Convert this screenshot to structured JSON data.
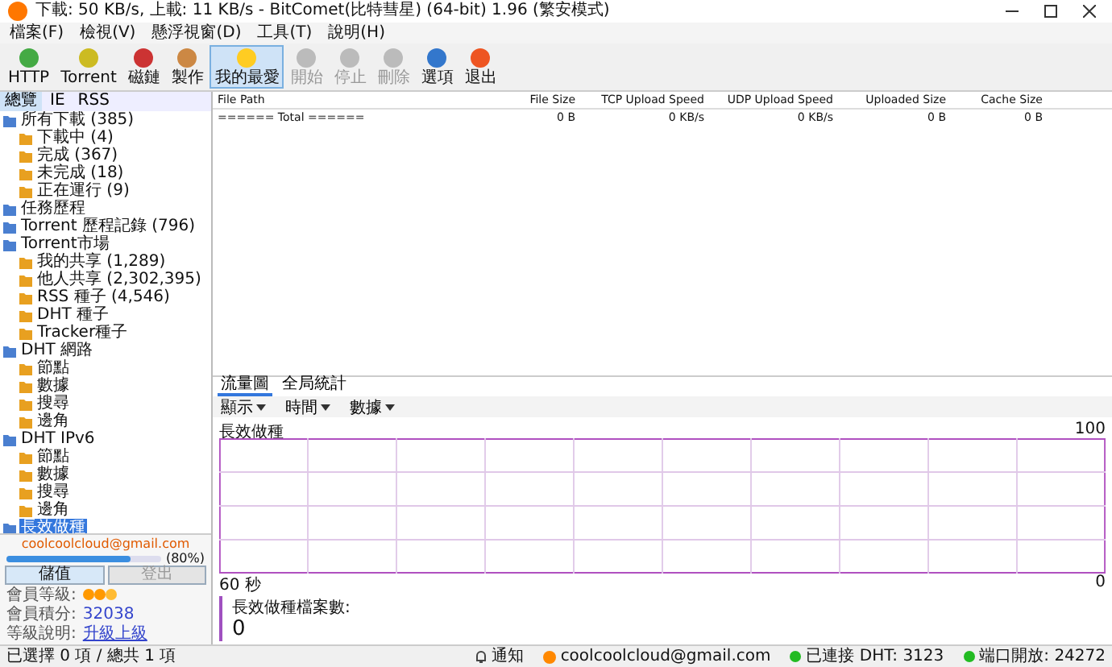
{
  "title_bar": {
    "title": "下載: 50 KB/s, 上載: 11 KB/s - BitComet(比特彗星) (64-bit) 1.96 (繁安模式)"
  },
  "menu": [
    "檔案(F)",
    "檢視(V)",
    "懸浮視窗(D)",
    "工具(T)",
    "說明(H)"
  ],
  "toolbar": [
    {
      "label": "HTTP",
      "disabled": false,
      "selected": false
    },
    {
      "label": "Torrent",
      "disabled": false,
      "selected": false
    },
    {
      "label": "磁鏈",
      "disabled": false,
      "selected": false
    },
    {
      "label": "製作",
      "disabled": false,
      "selected": false
    },
    {
      "label": "我的最愛",
      "disabled": false,
      "selected": true
    },
    {
      "label": "開始",
      "disabled": true,
      "selected": false
    },
    {
      "label": "停止",
      "disabled": true,
      "selected": false
    },
    {
      "label": "刪除",
      "disabled": true,
      "selected": false
    },
    {
      "label": "選項",
      "disabled": false,
      "selected": false
    },
    {
      "label": "退出",
      "disabled": false,
      "selected": false
    }
  ],
  "sidebar": {
    "tabs": [
      {
        "label": "總覽",
        "selected": true
      },
      {
        "label": "IE",
        "selected": false
      },
      {
        "label": "RSS",
        "selected": false
      }
    ],
    "tree": [
      {
        "label": "所有下載 (385)",
        "selected": false,
        "children": [
          {
            "label": "下載中 (4)",
            "selected": false
          },
          {
            "label": "完成 (367)",
            "selected": false
          },
          {
            "label": "未完成 (18)",
            "selected": false
          },
          {
            "label": "正在運行 (9)",
            "selected": false
          }
        ]
      },
      {
        "label": "任務歷程",
        "selected": false
      },
      {
        "label": "Torrent 歷程記錄 (796)",
        "selected": false
      },
      {
        "label": "Torrent市場",
        "selected": false,
        "children": [
          {
            "label": "我的共享 (1,289)",
            "selected": false
          },
          {
            "label": "他人共享 (2,302,395)",
            "selected": false
          },
          {
            "label": "RSS 種子 (4,546)",
            "selected": false
          },
          {
            "label": "DHT 種子",
            "selected": false
          },
          {
            "label": "Tracker種子",
            "selected": false
          }
        ]
      },
      {
        "label": "DHT 網路",
        "selected": false,
        "children": [
          {
            "label": "節點",
            "selected": false
          },
          {
            "label": "數據",
            "selected": false
          },
          {
            "label": "搜尋",
            "selected": false
          },
          {
            "label": "邊角",
            "selected": false
          }
        ]
      },
      {
        "label": "DHT IPv6",
        "selected": false,
        "children": [
          {
            "label": "節點",
            "selected": false
          },
          {
            "label": "數據",
            "selected": false
          },
          {
            "label": "搜尋",
            "selected": false
          },
          {
            "label": "邊角",
            "selected": false
          }
        ]
      },
      {
        "label": "長效做種",
        "selected": true
      }
    ],
    "account": {
      "email": "coolcoolcloud@gmail.com",
      "level": 0.8,
      "reading": "(80%)",
      "buttons": [
        {
          "label": "儲值",
          "disabled": false
        },
        {
          "label": "登出",
          "disabled": true
        }
      ],
      "info": [
        {
          "label": "會員等級:",
          "kind": "icons"
        },
        {
          "label": "會員積分:",
          "kind": "text",
          "value": "32038"
        },
        {
          "label": "等級說明:",
          "kind": "link",
          "value": "升級上級"
        }
      ]
    }
  },
  "table": {
    "columns": [
      "File Path",
      "File Size",
      "TCP Upload Speed",
      "UDP Upload Speed",
      "Uploaded Size",
      "Cache Size"
    ],
    "rows": [
      [
        "====== Total ======",
        "0 B",
        "0 KB/s",
        "0 KB/s",
        "0 B",
        "0 B"
      ]
    ]
  },
  "bottom_panel": {
    "tabs": [
      {
        "label": "流量圖",
        "selected": true
      },
      {
        "label": "全局統計",
        "selected": false
      }
    ],
    "tools": [
      "顯示",
      "時間",
      "數據"
    ],
    "chart": {
      "title": "長效做種",
      "top_label": "100",
      "left_label": "60 秒",
      "bottom_label": "0"
    },
    "counter": {
      "label": "長效做種檔案數:",
      "value": "0"
    }
  },
  "status_bar": {
    "left": "已選擇 0 項 / 總共 1 項",
    "items": [
      {
        "kind": "notice",
        "text": "通知"
      },
      {
        "kind": "user",
        "text": "coolcoolcloud@gmail.com"
      },
      {
        "kind": "dot",
        "text": "已連接 DHT:  3123",
        "color": "#22bb22"
      },
      {
        "kind": "dot",
        "text": "端口開放:  24272",
        "color": "#22bb22"
      }
    ]
  }
}
